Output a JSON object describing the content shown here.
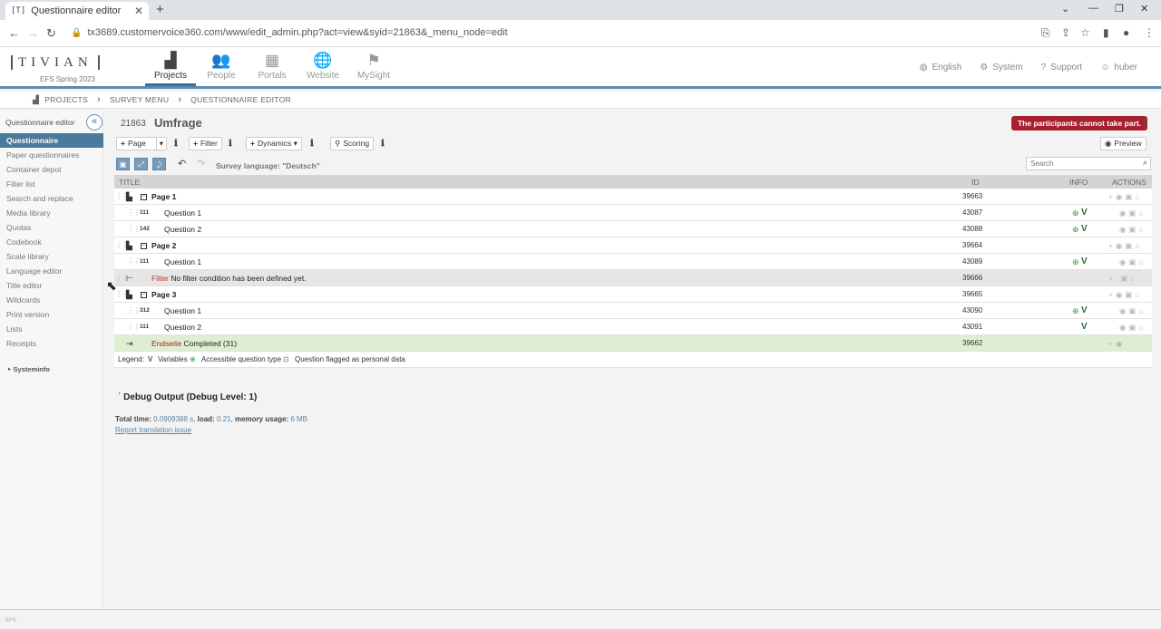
{
  "browser": {
    "tab_title": "Questionnaire editor",
    "tab_favicon": "[T]",
    "url": "tx3689.customervoice360.com/www/edit_admin.php?act=view&syid=21863&_menu_node=edit"
  },
  "header": {
    "logo": "TIVIAN",
    "logo_sub": "EFS Spring 2023",
    "nav": [
      {
        "label": "Projects",
        "icon": "bar-chart-icon"
      },
      {
        "label": "People",
        "icon": "people-icon"
      },
      {
        "label": "Portals",
        "icon": "grid-icon"
      },
      {
        "label": "Website",
        "icon": "globe-icon"
      },
      {
        "label": "MySight",
        "icon": "lighthouse-icon"
      }
    ],
    "right": [
      {
        "label": "English",
        "icon": "globe-icon"
      },
      {
        "label": "System",
        "icon": "gear-icon"
      },
      {
        "label": "Support",
        "icon": "question-icon"
      },
      {
        "label": "huber",
        "icon": "user-icon"
      }
    ]
  },
  "breadcrumb": [
    "PROJECTS",
    "SURVEY MENU",
    "QUESTIONNAIRE EDITOR"
  ],
  "sidebar": {
    "title": "Questionnaire editor",
    "items": [
      "Questionnaire",
      "Paper questionnaires",
      "Container depot",
      "Filter list",
      "Search and replace",
      "Media library",
      "Quotas",
      "Codebook",
      "Scale library",
      "Language editor",
      "Title editor",
      "Wildcards",
      "Print version",
      "Lists",
      "Receipts"
    ],
    "systeminfo": "Systeminfo"
  },
  "project": {
    "id": "21863",
    "title": "Umfrage",
    "status": "The participants cannot take part."
  },
  "toolbar": {
    "page": "Page",
    "filter": "Filter",
    "dynamics": "Dynamics",
    "scoring": "Scoring",
    "preview": "Preview",
    "survey_language": "Survey language: \"Deutsch\"",
    "search_placeholder": "Search"
  },
  "table": {
    "headers": {
      "title": "TITLE",
      "id": "ID",
      "info": "INFO",
      "actions": "ACTIONS"
    },
    "rows": [
      {
        "kind": "page",
        "label": "Page 1",
        "id": "39663"
      },
      {
        "kind": "question",
        "qtype": "111",
        "label": "Question 1",
        "id": "43087"
      },
      {
        "kind": "question",
        "qtype": "142",
        "label": "Question 2",
        "id": "43088"
      },
      {
        "kind": "page",
        "label": "Page 2",
        "id": "39664"
      },
      {
        "kind": "question",
        "qtype": "111",
        "label": "Question 1",
        "id": "43089"
      },
      {
        "kind": "filter",
        "keyword": "Filter",
        "label": "No filter condition has been defined yet.",
        "id": "39666"
      },
      {
        "kind": "page",
        "label": "Page 3",
        "id": "39665"
      },
      {
        "kind": "question",
        "qtype": "312",
        "label": "Question 1",
        "id": "43090"
      },
      {
        "kind": "question",
        "qtype": "111",
        "label": "Question 2",
        "id": "43091"
      },
      {
        "kind": "end",
        "keyword": "Endseite",
        "label": "Completed (31)",
        "id": "39662"
      }
    ],
    "legend": {
      "label": "Legend:",
      "variables": "Variables",
      "accessible": "Accessible question type",
      "flagged": "Question flagged as personal data"
    }
  },
  "debug": {
    "title": "Debug Output (Debug Level: 1)",
    "total_time_label": "Total time:",
    "total_time": "0.0909388 s",
    "load_label": "load:",
    "load": "0.21",
    "memory_label": "memory usage:",
    "memory": "6 MB",
    "report_link": "Report translation issue"
  },
  "footer": "EFS"
}
